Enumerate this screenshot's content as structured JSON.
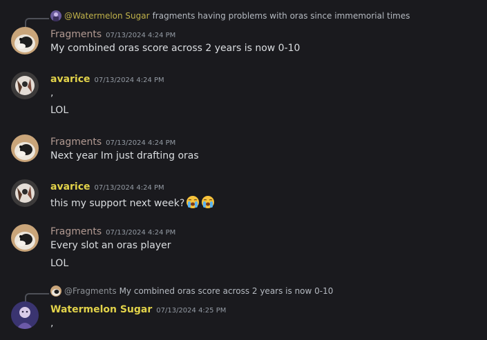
{
  "messages": [
    {
      "reply": {
        "author": "@Watermelon Sugar",
        "text": "fragments having problems with oras since immemorial times"
      },
      "author": "Fragments",
      "timestamp": "07/13/2024 4:24 PM",
      "lines": [
        "My combined oras score across 2 years is now 0-10"
      ]
    },
    {
      "author": "avarice",
      "timestamp": "07/13/2024 4:24 PM",
      "lines": [
        ",",
        "LOL"
      ]
    },
    {
      "author": "Fragments",
      "timestamp": "07/13/2024 4:24 PM",
      "lines": [
        "Next year Im just drafting oras"
      ]
    },
    {
      "author": "avarice",
      "timestamp": "07/13/2024 4:24 PM",
      "lines": [
        "this my support next week?"
      ],
      "emojis": [
        "loudly-crying-face-emoji",
        "loudly-crying-face-emoji"
      ]
    },
    {
      "author": "Fragments",
      "timestamp": "07/13/2024 4:24 PM",
      "lines": [
        "Every slot an oras player",
        "LOL"
      ]
    },
    {
      "reply": {
        "author": "@Fragments",
        "text": "My combined oras score across 2 years is now 0-10"
      },
      "author": "Watermelon Sugar",
      "timestamp": "07/13/2024 4:25 PM",
      "lines": [
        ","
      ]
    }
  ],
  "colors": {
    "background": "#1a1a1e",
    "text": "#dbdee1",
    "timestamp": "#949ba4",
    "fragments_name": "#b29a92",
    "avarice_name": "#e2d34a",
    "watermelon_name": "#e2d34a"
  }
}
